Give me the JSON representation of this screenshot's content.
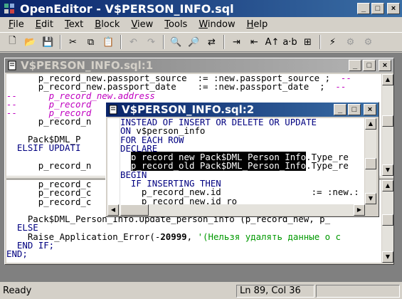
{
  "app": {
    "title": "OpenEditor - V$PERSON_INFO.sql"
  },
  "window_buttons": {
    "minimize": "_",
    "maximize": "□",
    "close": "×"
  },
  "menu": [
    {
      "hot": "F",
      "rest": "ile"
    },
    {
      "hot": "E",
      "rest": "dit"
    },
    {
      "hot": "T",
      "rest": "ext"
    },
    {
      "hot": "B",
      "rest": "lock"
    },
    {
      "hot": "V",
      "rest": "iew"
    },
    {
      "hot": "T",
      "rest": "ools"
    },
    {
      "hot": "W",
      "rest": "indow"
    },
    {
      "hot": "H",
      "rest": "elp"
    }
  ],
  "toolbar": [
    {
      "icon": "new-file-icon",
      "glyph": "🗋"
    },
    {
      "icon": "open-folder-icon",
      "glyph": "📂"
    },
    {
      "icon": "save-icon",
      "glyph": "💾"
    },
    {
      "icon": "cut-icon",
      "glyph": "✂"
    },
    {
      "icon": "copy-icon",
      "glyph": "⧉"
    },
    {
      "icon": "paste-icon",
      "glyph": "📋"
    },
    {
      "icon": "undo-icon",
      "glyph": "↶"
    },
    {
      "icon": "redo-icon",
      "glyph": "↷"
    },
    {
      "icon": "find-icon",
      "glyph": "🔍"
    },
    {
      "icon": "find-next-icon",
      "glyph": "🔎"
    },
    {
      "icon": "replace-icon",
      "glyph": "⇄"
    },
    {
      "icon": "indent-icon",
      "glyph": "⇥"
    },
    {
      "icon": "outdent-icon",
      "glyph": "⇤"
    },
    {
      "icon": "uppercase-icon",
      "glyph": "A↑"
    },
    {
      "icon": "case-toggle-icon",
      "glyph": "a·b"
    },
    {
      "icon": "compare-icon",
      "glyph": "⊞"
    },
    {
      "icon": "execute-icon",
      "glyph": "⚡"
    },
    {
      "icon": "tool-a-icon",
      "glyph": "⚙"
    },
    {
      "icon": "tool-b-icon",
      "glyph": "⚙"
    }
  ],
  "child_window_1": {
    "title": "V$PERSON_INFO.sql:1",
    "top_lines": [
      [
        {
          "t": "      p_record_new.passport_source  "
        },
        {
          "t": ":= :new.passport_source ;  "
        },
        {
          "t": "--",
          "c": "cm"
        }
      ],
      [
        {
          "t": "      p_record_new.passport_date    "
        },
        {
          "t": ":= :new.passport_date  ;  "
        },
        {
          "t": "--",
          "c": "cm"
        }
      ],
      [
        {
          "t": "--      p_record_new.address",
          "c": "cm"
        }
      ],
      [
        {
          "t": "--      p_record",
          "c": "cm"
        }
      ],
      [
        {
          "t": "--      p_record",
          "c": "cm"
        }
      ],
      [
        {
          "t": "      p_record_n"
        }
      ],
      [
        {
          "t": ""
        }
      ],
      [
        {
          "t": "    Pack$DML_P"
        }
      ],
      [
        {
          "t": "  ELSIF UPDATI",
          "c": "kw"
        }
      ],
      [
        {
          "t": ""
        }
      ],
      [
        {
          "t": "      p_record_n"
        }
      ]
    ],
    "bottom_lines": [
      [
        {
          "t": "      p_record_c"
        }
      ],
      [
        {
          "t": "      p_record_c"
        }
      ],
      [
        {
          "t": "      p_record_c"
        }
      ],
      [
        {
          "t": ""
        }
      ],
      [
        {
          "t": "    Pack$DML_Person_Info.Update_person_info (p_record_new, p_"
        }
      ],
      [
        {
          "t": "  ELSE",
          "c": "kw"
        }
      ],
      [
        {
          "t": "    Raise_Application_Error(-"
        },
        {
          "t": "20999",
          "c": "num"
        },
        {
          "t": ", "
        },
        {
          "t": "'(Нельзя удалять данные о с",
          "c": "str"
        }
      ],
      [
        {
          "t": "  END IF;",
          "c": "kw"
        }
      ],
      [
        {
          "t": "END;",
          "c": "kw"
        }
      ]
    ]
  },
  "child_window_2": {
    "title": "V$PERSON_INFO.sql:2",
    "lines": [
      [
        {
          "t": "INSTEAD OF INSERT OR DELETE OR UPDATE",
          "c": "kw"
        }
      ],
      [
        {
          "t": "ON ",
          "c": "kw"
        },
        {
          "t": "v$person_info"
        }
      ],
      [
        {
          "t": "FOR EACH ROW",
          "c": "kw"
        }
      ],
      [
        {
          "t": "DECLARE",
          "c": "kw"
        }
      ],
      [
        {
          "t": "  "
        },
        {
          "t": "p_record_new Pack$DML_Person_Info",
          "c": "sel"
        },
        {
          "t": ".Type_re"
        }
      ],
      [
        {
          "t": "  "
        },
        {
          "t": "p_record_old Pack$DML_Person_Info",
          "c": "sel"
        },
        {
          "t": ".Type_re"
        }
      ],
      [
        {
          "t": "BEGIN",
          "c": "kw"
        }
      ],
      [
        {
          "t": "  IF INSERTING THEN",
          "c": "kw"
        }
      ],
      [
        {
          "t": "    p_record_new.id                 "
        },
        {
          "t": ":= :new.:"
        }
      ],
      [
        {
          "t": "    p_record_new.id_ro              "
        }
      ]
    ]
  },
  "status": {
    "text": "Ready",
    "position": "Ln 89, Col 36"
  }
}
